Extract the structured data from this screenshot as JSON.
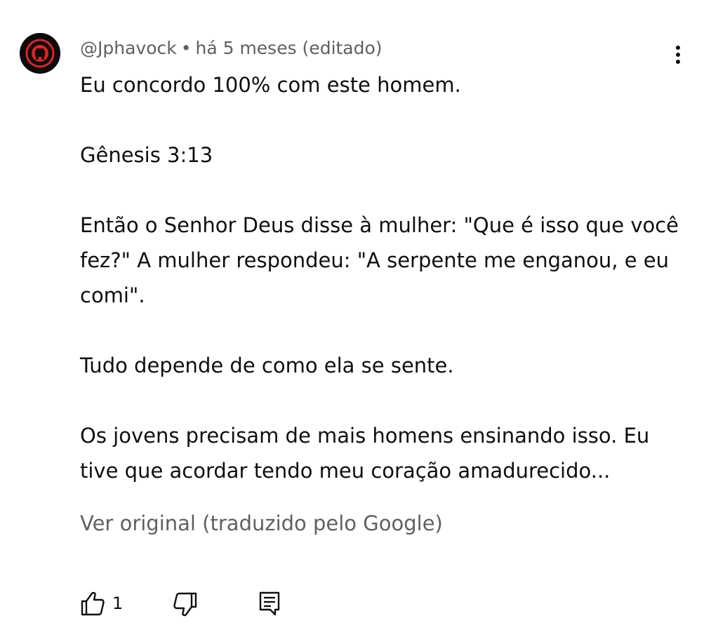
{
  "comment": {
    "author": "@Jphavock",
    "separator": "•",
    "timestamp": "há 5 meses (editado)",
    "paragraphs": [
      "Eu concordo 100% com este homem.",
      "Gênesis 3:13",
      "Então o Senhor Deus disse à mulher: \"Que é isso que você fez?\" A mulher respondeu: \"A serpente me enganou, e eu comi\".",
      "Tudo depende de como ela se sente.",
      "Os jovens precisam de mais homens ensinando isso. Eu tive que acordar tendo meu coração amadurecido..."
    ],
    "translation_link": "Ver original (traduzido pelo Google)",
    "like_count": "1"
  },
  "icons": {
    "more": "more-vert-icon",
    "like": "thumb-up-icon",
    "dislike": "thumb-down-icon",
    "reply": "comment-icon"
  },
  "colors": {
    "text": "#0f0f0f",
    "secondary_text": "#606060",
    "avatar_bg": "#0b0b0b",
    "avatar_accent": "#e0231c"
  }
}
